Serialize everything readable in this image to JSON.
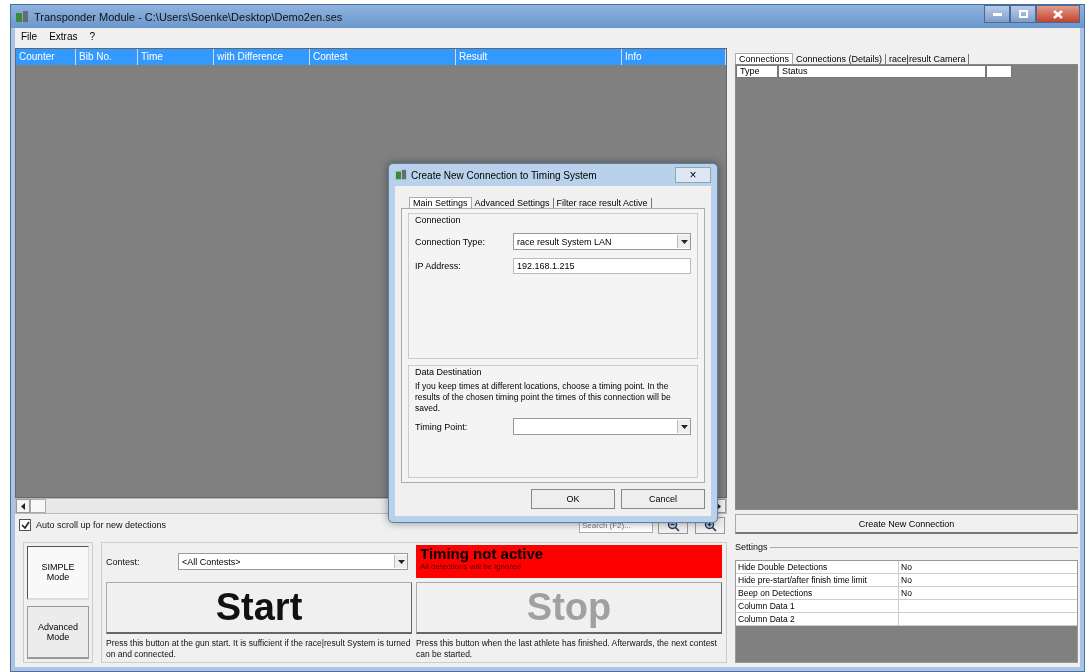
{
  "window": {
    "title": "Transponder Module - C:\\Users\\Soenke\\Desktop\\Demo2en.ses"
  },
  "menu": [
    "File",
    "Extras",
    "?"
  ],
  "detections_table": {
    "columns": [
      "Counter",
      "Bib No.",
      "Time",
      "with Difference",
      "Contest",
      "Result",
      "Info"
    ]
  },
  "auto_scroll": {
    "label": "Auto scroll up for new detections",
    "checked": true
  },
  "search": {
    "placeholder": "Search (F2)..."
  },
  "modes": [
    {
      "label": "SIMPLE Mode",
      "selected": true
    },
    {
      "label": "Advanced Mode",
      "selected": false
    }
  ],
  "contest": {
    "label": "Contest:",
    "value": "<All Contests>"
  },
  "timing_status": {
    "title": "Timing not active",
    "subtitle": "All detections will be ignored",
    "active": false
  },
  "start": {
    "label": "Start",
    "disabled": false,
    "help": "Press this button at the gun start. It is sufficient if the race|result System is turned on and connected."
  },
  "stop": {
    "label": "Stop",
    "disabled": true,
    "help": "Press this button when the last athlete has finished. Afterwards, the next contest can be started."
  },
  "right_tabs": [
    {
      "label": "Connections",
      "selected": true
    },
    {
      "label": "Connections (Details)",
      "selected": false
    },
    {
      "label": "race|result Camera",
      "selected": false
    }
  ],
  "connections_table": {
    "columns": [
      "Type",
      "Status"
    ]
  },
  "create_button": "Create New Connection",
  "settings": {
    "title": "Settings",
    "rows": [
      {
        "name": "Hide Double Detections",
        "value": "No"
      },
      {
        "name": "Hide pre-start/after finish time limit",
        "value": "No"
      },
      {
        "name": "Beep on Detections",
        "value": "No"
      },
      {
        "name": "Column Data 1"
      },
      {
        "name": "Column Data 2"
      }
    ]
  },
  "dialog": {
    "title": "Create New Connection to Timing System",
    "close": "×",
    "tabs": [
      {
        "label": "Main Settings",
        "selected": true
      },
      {
        "label": "Advanced Settings",
        "selected": false
      },
      {
        "label": "Filter race result Active",
        "selected": false
      }
    ],
    "connection_group": "Connection",
    "connection_type": {
      "label": "Connection Type:",
      "value": "race result System LAN"
    },
    "ip_address": {
      "label": "IP Address:",
      "value": "192.168.1.215"
    },
    "destination_group": "Data Destination",
    "destination_text": "If you keep times at different locations, choose a timing point. In the results of the chosen timing point the times of this connection will be saved.",
    "timing_point": {
      "label": "Timing Point:"
    },
    "buttons": [
      "OK",
      "Cancel"
    ]
  }
}
